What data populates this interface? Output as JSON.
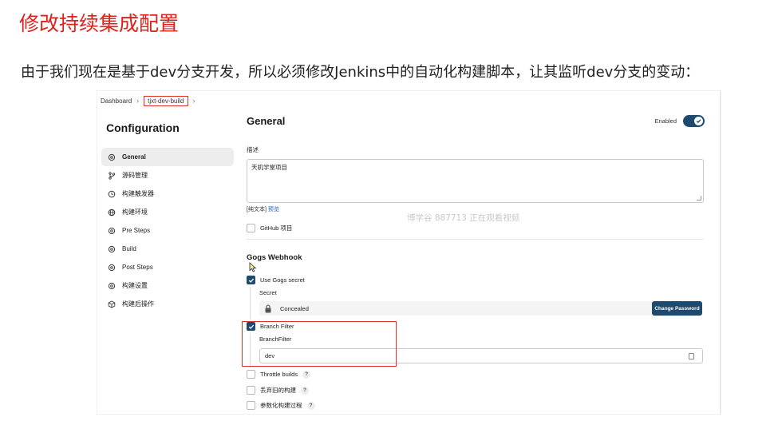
{
  "doc": {
    "title": "修改持续集成配置",
    "paragraph": "由于我们现在是基于dev分支开发，所以必须修改Jenkins中的自动化构建脚本，让其监听dev分支的变动："
  },
  "breadcrumb": {
    "home": "Dashboard",
    "job": "tjxt-dev-build"
  },
  "sidebar": {
    "title": "Configuration",
    "items": [
      {
        "label": "General",
        "icon": "gear-icon",
        "active": true
      },
      {
        "label": "源码管理",
        "icon": "branch-icon",
        "active": false
      },
      {
        "label": "构建触发器",
        "icon": "clock-icon",
        "active": false
      },
      {
        "label": "构建环境",
        "icon": "globe-icon",
        "active": false
      },
      {
        "label": "Pre Steps",
        "icon": "gear-icon",
        "active": false
      },
      {
        "label": "Build",
        "icon": "gear-icon",
        "active": false
      },
      {
        "label": "Post Steps",
        "icon": "gear-icon",
        "active": false
      },
      {
        "label": "构建设置",
        "icon": "gear-icon",
        "active": false
      },
      {
        "label": "构建后操作",
        "icon": "cube-icon",
        "active": false
      }
    ]
  },
  "main": {
    "title": "General",
    "enabled_label": "Enabled",
    "enabled": true,
    "description_label": "描述",
    "description_value": "天机学堂项目",
    "text_mode": "[纯文本]",
    "preview_link": "预览",
    "github_project_label": "GitHub 项目",
    "github_project_checked": false,
    "watermark": "博学谷 887713 正在观看视频",
    "gogs": {
      "section_title": "Gogs Webhook",
      "use_secret_label": "Use Gogs secret",
      "use_secret_checked": true,
      "secret_label": "Secret",
      "secret_value": "Concealed",
      "change_password_button": "Change Password",
      "branch_filter_label": "Branch Filter",
      "branch_filter_checked": true,
      "branchfilter_field_label": "BranchFilter",
      "branchfilter_value": "dev"
    },
    "options": [
      {
        "label": "Throttle builds",
        "checked": false
      },
      {
        "label": "丢弃旧的构建",
        "checked": false
      },
      {
        "label": "参数化构建过程",
        "checked": false
      }
    ],
    "help_glyph": "?"
  },
  "colors": {
    "title_red": "#e0201b",
    "accent_navy": "#1d4a6e",
    "highlight_red": "#e0302a",
    "link_blue": "#1565c0"
  }
}
